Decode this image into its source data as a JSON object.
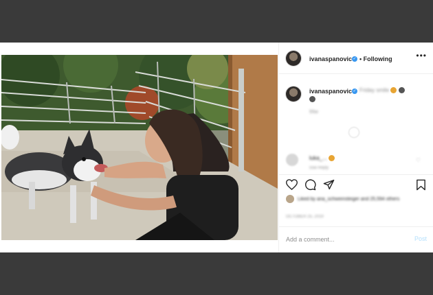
{
  "post": {
    "username": "ivanaspanovic",
    "follow_label": "Following",
    "more_label": "•••",
    "caption": {
      "username": "ivanaspanovic"
    },
    "comment": {
      "username": "luka_..."
    },
    "comment_box": {
      "placeholder": "Add a comment...",
      "post_label": "Post"
    }
  },
  "colors": {
    "background": "#3a3a3a",
    "verified": "#3897f0",
    "post_button_disabled": "#b2dffc"
  },
  "icons": [
    "verified-badge-icon",
    "more-options-icon",
    "heart-icon",
    "comment-icon",
    "share-icon",
    "bookmark-icon"
  ]
}
